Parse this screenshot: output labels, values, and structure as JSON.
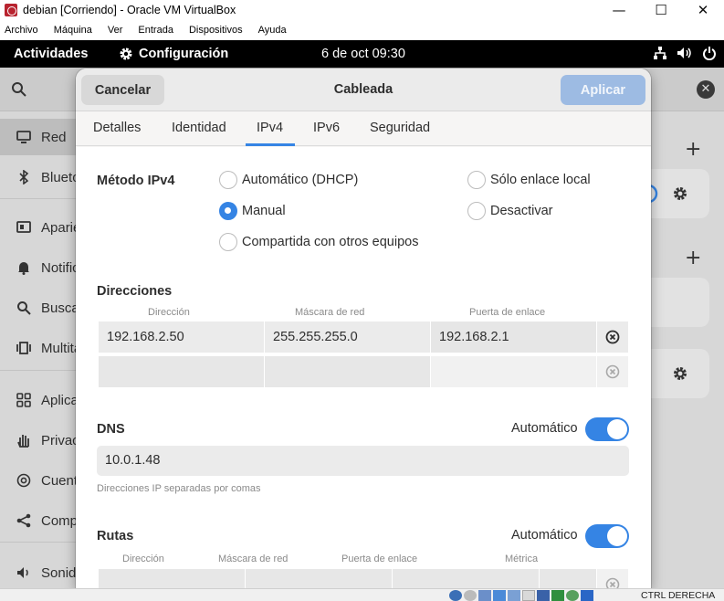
{
  "vbox": {
    "title": "debian [Corriendo] - Oracle VM VirtualBox",
    "minimize": "—",
    "maximize": "☐",
    "close": "✕",
    "menu": [
      "Archivo",
      "Máquina",
      "Ver",
      "Entrada",
      "Dispositivos",
      "Ayuda"
    ],
    "host_key": "CTRL DERECHA"
  },
  "topbar": {
    "activities": "Actividades",
    "app_name": "Configuración",
    "clock": "6 de oct  09:30"
  },
  "sidebar": {
    "items": [
      {
        "label": "Red",
        "icon": "monitor-icon"
      },
      {
        "label": "Bluetooth",
        "icon": "bluetooth-icon"
      },
      {
        "label": "Apariencia",
        "icon": "appearance-icon"
      },
      {
        "label": "Notificaciones",
        "icon": "bell-icon"
      },
      {
        "label": "Buscar",
        "icon": "search-icon"
      },
      {
        "label": "Multitarea",
        "icon": "multitask-icon"
      },
      {
        "label": "Aplicaciones",
        "icon": "apps-icon"
      },
      {
        "label": "Privacidad",
        "icon": "hand-icon"
      },
      {
        "label": "Cuentas en línea",
        "icon": "at-icon"
      },
      {
        "label": "Compartir",
        "icon": "share-icon"
      },
      {
        "label": "Sonido",
        "icon": "speaker-icon"
      }
    ]
  },
  "dialog": {
    "cancel": "Cancelar",
    "title": "Cableada",
    "apply": "Aplicar",
    "tabs": [
      "Detalles",
      "Identidad",
      "IPv4",
      "IPv6",
      "Seguridad"
    ],
    "active_tab": "IPv4",
    "method": {
      "label": "Método IPv4",
      "options": [
        "Automático (DHCP)",
        "Sólo enlace local",
        "Manual",
        "Desactivar",
        "Compartida con otros equipos"
      ],
      "selected": "Manual"
    },
    "addresses": {
      "title": "Direcciones",
      "headers": [
        "Dirección",
        "Máscara de red",
        "Puerta de enlace"
      ],
      "rows": [
        [
          "192.168.2.50",
          "255.255.255.0",
          "192.168.2.1"
        ],
        [
          "",
          "",
          ""
        ]
      ]
    },
    "dns": {
      "title": "DNS",
      "auto_label": "Automático",
      "auto_on": true,
      "value": "10.0.1.48",
      "hint": "Direcciones IP separadas por comas"
    },
    "routes": {
      "title": "Rutas",
      "auto_label": "Automático",
      "auto_on": true,
      "headers": [
        "Dirección",
        "Máscara de red",
        "Puerta de enlace",
        "Métrica"
      ]
    }
  }
}
